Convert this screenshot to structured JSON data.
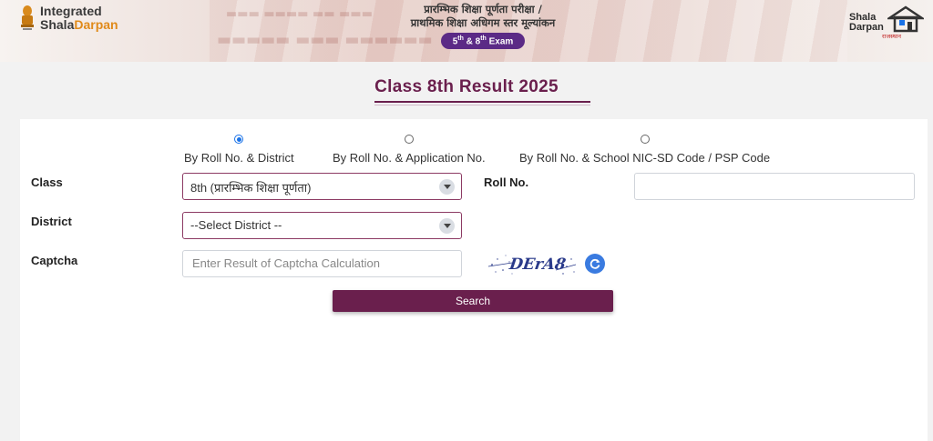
{
  "header": {
    "logo_line1": "Integrated",
    "logo_line2_a": "Shala",
    "logo_line2_b": "Darpan",
    "hindi_line1": "प्रारम्भिक शिक्षा पूर्णता परीक्षा /",
    "hindi_line2": "प्राथमिक शिक्षा अधिगम स्तर मूल्यांकन",
    "exam_badge": {
      "n1": "5",
      "s1": "th",
      "amp": " & ",
      "n2": "8",
      "s2": "th",
      "word": " Exam"
    },
    "right_logo": {
      "line1": "Shala",
      "line2": "Darpan",
      "tagline": "राजस्थान"
    }
  },
  "page_title": "Class 8th Result 2025",
  "search_options": [
    {
      "label": "By Roll No. & District",
      "selected": true
    },
    {
      "label": "By Roll No. & Application No.",
      "selected": false
    },
    {
      "label": "By Roll No. & School NIC-SD Code / PSP Code",
      "selected": false
    }
  ],
  "form": {
    "class_label": "Class",
    "class_value": "8th (प्रारम्भिक शिक्षा पूर्णता)",
    "district_label": "District",
    "district_value": "--Select District --",
    "captcha_label": "Captcha",
    "captcha_placeholder": "Enter Result of Captcha Calculation",
    "captcha_text": "DErA8",
    "roll_label": "Roll No.",
    "roll_value": "",
    "search_button": "Search"
  },
  "icons": {
    "dropdown": "chevron-down-icon",
    "refresh": "refresh-icon",
    "emblem": "state-emblem-icon",
    "house": "house-icon"
  },
  "colors": {
    "primary": "#6a1f4d",
    "badge": "#5b2a86",
    "radio_selected": "#1a73e8",
    "refresh": "#3a7be0"
  }
}
